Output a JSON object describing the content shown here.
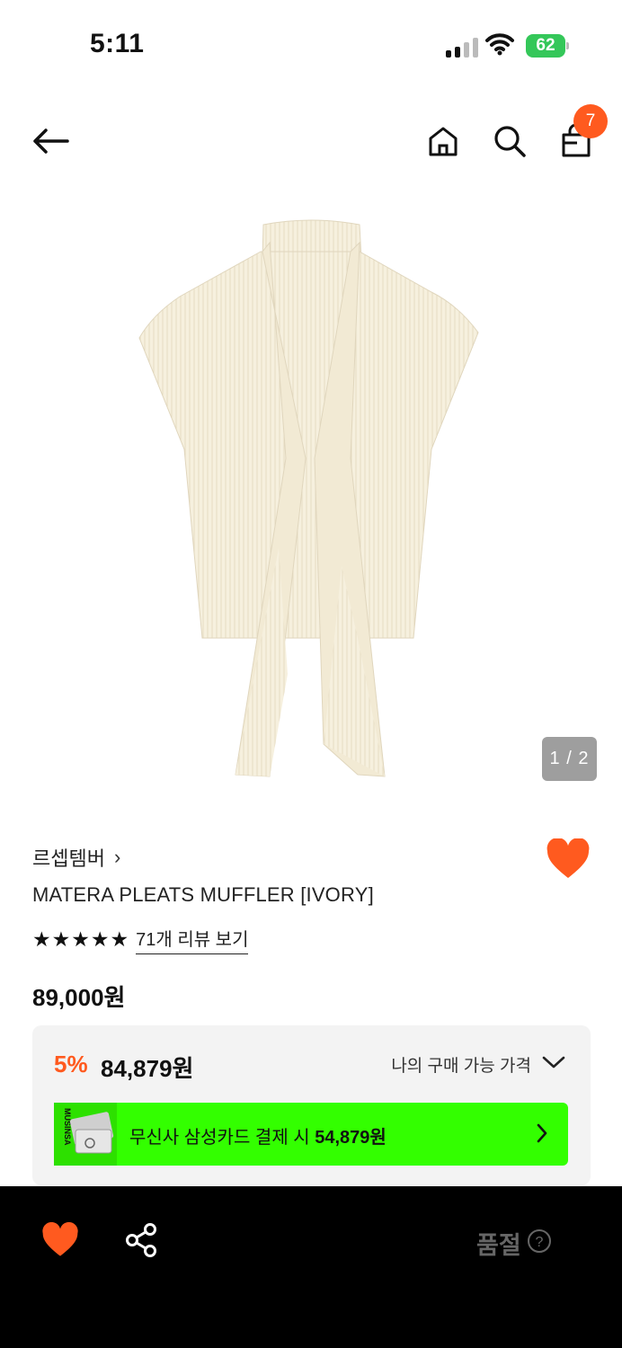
{
  "status_bar": {
    "time": "5:11",
    "battery_level": "62",
    "battery_color": "#34c759"
  },
  "nav": {
    "back_icon": "arrow-left-icon",
    "home_icon": "home-icon",
    "search_icon": "search-icon",
    "cart_icon": "shopping-bag-icon",
    "cart_count": "7",
    "badge_color": "#ff5a1f"
  },
  "gallery": {
    "counter": "1 / 2"
  },
  "product": {
    "brand": "르셉템버",
    "brand_chevron": "›",
    "title": "MATERA PLEATS MUFFLER [IVORY]",
    "rating_stars": 5,
    "review_link": "71개 리뷰 보기",
    "original_price": "89,000원"
  },
  "price_box": {
    "discount_rate": "5%",
    "discount_price": "84,879원",
    "my_price_label": "나의 구매 가능 가격",
    "card_banner_prefix": "무신사 삼성카드 결제 시",
    "card_banner_price": "54,879원",
    "card_brand_vertical": "MUSINSA",
    "banner_color": "#33ff00"
  },
  "bottom_bar": {
    "wishlist_icon": "heart-icon",
    "share_icon": "share-icon",
    "status": "품절",
    "help_icon": "question-circle-icon",
    "accent_color": "#ff5a1f"
  }
}
